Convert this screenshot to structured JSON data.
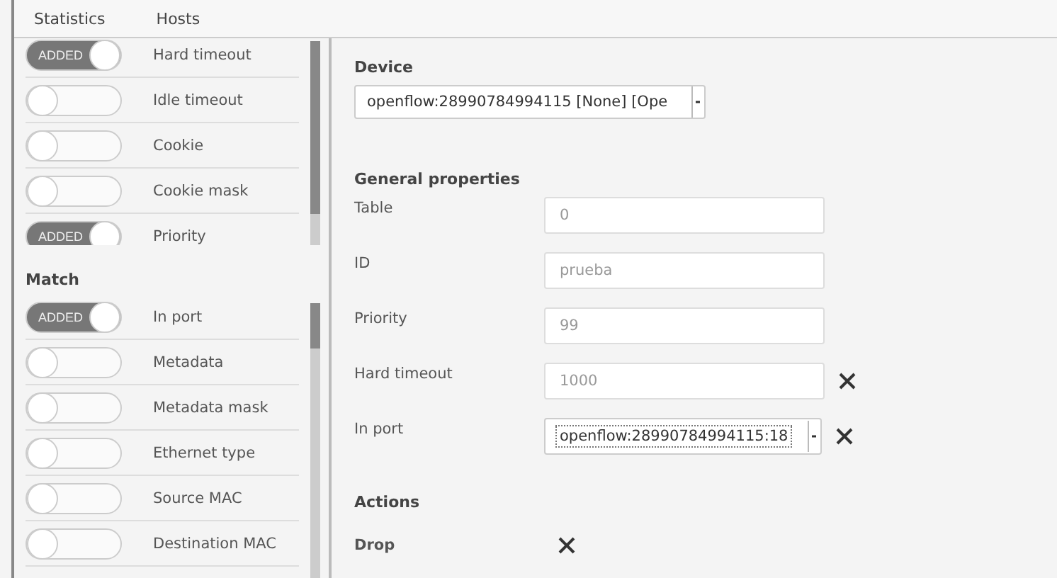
{
  "tabs": [
    {
      "label": "Statistics",
      "selected": false
    },
    {
      "label": "Hosts",
      "selected": false
    }
  ],
  "flow_options": [
    {
      "label": "Hard timeout",
      "on": true,
      "badge": "ADDED"
    },
    {
      "label": "Idle timeout",
      "on": false
    },
    {
      "label": "Cookie",
      "on": false
    },
    {
      "label": "Cookie mask",
      "on": false
    },
    {
      "label": "Priority",
      "on": true,
      "badge": "ADDED"
    }
  ],
  "match": {
    "title": "Match",
    "items": [
      {
        "label": "In port",
        "on": true,
        "badge": "ADDED"
      },
      {
        "label": "Metadata",
        "on": false
      },
      {
        "label": "Metadata mask",
        "on": false
      },
      {
        "label": "Ethernet type",
        "on": false
      },
      {
        "label": "Source MAC",
        "on": false
      },
      {
        "label": "Destination MAC",
        "on": false
      }
    ]
  },
  "device": {
    "label": "Device",
    "value": "openflow:28990784994115 [None] [Ope"
  },
  "general": {
    "title": "General properties",
    "rows": [
      {
        "label": "Table",
        "kind": "input",
        "placeholder": "0",
        "removable": false
      },
      {
        "label": "ID",
        "kind": "input",
        "placeholder": "prueba",
        "removable": false
      },
      {
        "label": "Priority",
        "kind": "input",
        "placeholder": "99",
        "removable": false
      },
      {
        "label": "Hard timeout",
        "kind": "input",
        "placeholder": "1000",
        "removable": true
      },
      {
        "label": "In port",
        "kind": "select",
        "value": "openflow:28990784994115:18",
        "removable": true
      }
    ]
  },
  "actions": {
    "title": "Actions",
    "items": [
      {
        "label": "Drop",
        "removable": true
      }
    ]
  }
}
